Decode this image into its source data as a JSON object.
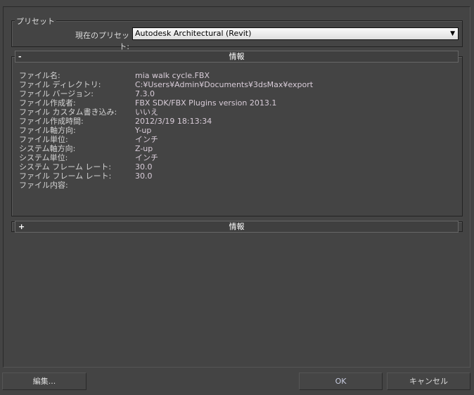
{
  "preset": {
    "legend": "プリセット",
    "label": "現在のプリセット:",
    "selected": "Autodesk Architectural (Revit)"
  },
  "rollout1": {
    "sign": "-",
    "title": "情報"
  },
  "rollout2": {
    "sign": "+",
    "title": "情報"
  },
  "info": [
    {
      "label": "ファイル名:",
      "value": "mia walk cycle.FBX"
    },
    {
      "label": "ファイル ディレクトリ:",
      "value": "C:¥Users¥Admin¥Documents¥3dsMax¥export"
    },
    {
      "label": "ファイル バージョン:",
      "value": "7.3.0"
    },
    {
      "label": "ファイル作成者:",
      "value": "FBX SDK/FBX Plugins version 2013.1"
    },
    {
      "label": "ファイル カスタム書き込み:",
      "value": "いいえ"
    },
    {
      "label": "ファイル作成時間:",
      "value": "2012/3/19  18:13:34"
    },
    {
      "label": "ファイル軸方向:",
      "value": "Y-up"
    },
    {
      "label": "ファイル単位:",
      "value": "インチ"
    },
    {
      "label": "システム軸方向:",
      "value": "Z-up"
    },
    {
      "label": "システム単位:",
      "value": "インチ"
    },
    {
      "label": "システム フレーム レート:",
      "value": "30.0"
    },
    {
      "label": "ファイル フレーム レート:",
      "value": "30.0"
    },
    {
      "label": "ファイル内容:",
      "value": ""
    }
  ],
  "buttons": {
    "edit": "編集...",
    "ok": "OK",
    "cancel": "キャンセル"
  }
}
